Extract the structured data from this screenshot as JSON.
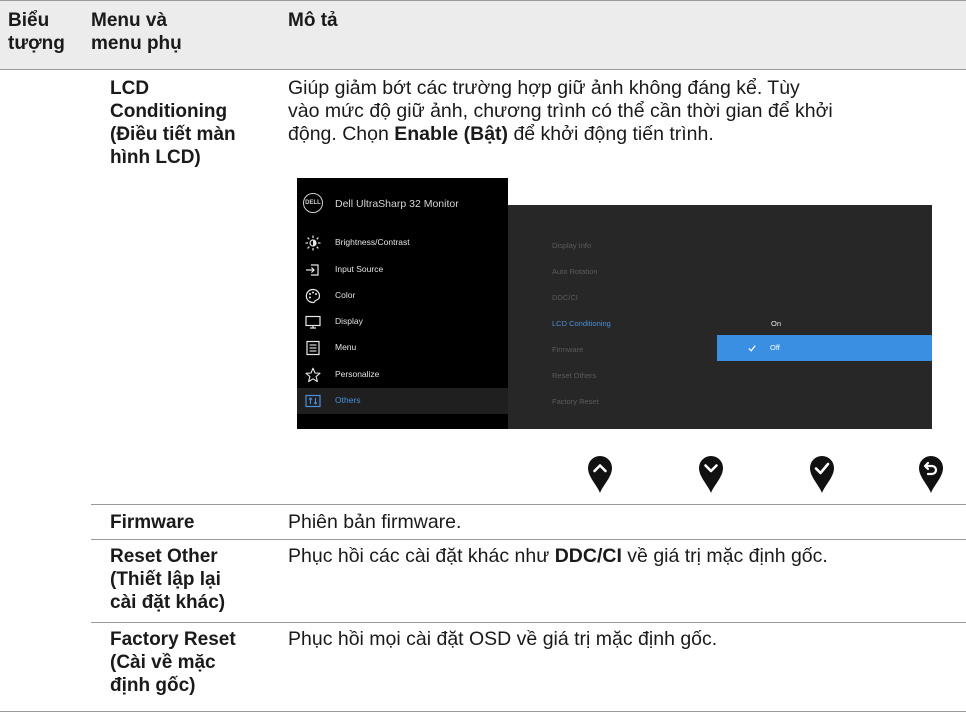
{
  "header": {
    "col1": [
      "Biểu",
      "tượng"
    ],
    "col2": [
      "Menu và",
      "menu phụ"
    ],
    "col3": "Mô tả"
  },
  "rows": [
    {
      "name": [
        "LCD",
        "Conditioning",
        "(Điều tiết màn",
        "hình LCD)"
      ],
      "desc_lines": [
        [
          "Giúp giảm bớt các trường hợp giữ ảnh không đáng kể. Tùy"
        ],
        [
          "vào mức độ giữ ảnh, chương trình có thể cần thời gian để khởi"
        ],
        [
          "động. Chọn ",
          "Enable (Bật)",
          " để khởi động tiến trình."
        ]
      ]
    },
    {
      "name": [
        "Firmware"
      ],
      "desc_lines": [
        [
          "Phiên bản firmware."
        ]
      ]
    },
    {
      "name": [
        "Reset Other",
        "(Thiết lập lại",
        "cài đặt khác)"
      ],
      "desc_lines": [
        [
          "Phục hồi các cài đặt khác như ",
          "DDC/CI",
          " về giá trị mặc định gốc."
        ]
      ]
    },
    {
      "name": [
        "Factory Reset",
        "(Cài về mặc",
        "định gốc)"
      ],
      "desc_lines": [
        [
          "Phục hồi mọi cài đặt OSD về giá trị mặc định gốc."
        ]
      ]
    }
  ],
  "osd": {
    "logo": "DELL",
    "title": "Dell UltraSharp 32 Monitor",
    "menu": [
      {
        "label": "Brightness/Contrast",
        "icon": "brightness-icon"
      },
      {
        "label": "Input Source",
        "icon": "input-source-icon"
      },
      {
        "label": "Color",
        "icon": "color-palette-icon"
      },
      {
        "label": "Display",
        "icon": "display-icon"
      },
      {
        "label": "Menu",
        "icon": "menu-icon"
      },
      {
        "label": "Personalize",
        "icon": "star-icon"
      },
      {
        "label": "Others",
        "icon": "others-icon"
      }
    ],
    "active_menu": "Others",
    "submenu": [
      "Display Info",
      "Auto Rotation",
      "DDC/CI",
      "LCD Conditioning",
      "Firmware",
      "Reset Others",
      "Factory Reset"
    ],
    "selected_submenu": "LCD Conditioning",
    "options": [
      "On",
      "Off"
    ],
    "selected_option": "Off",
    "accent_color": "#3b8fe3"
  },
  "buttons": [
    "up-icon",
    "down-icon",
    "check-icon",
    "back-icon"
  ]
}
